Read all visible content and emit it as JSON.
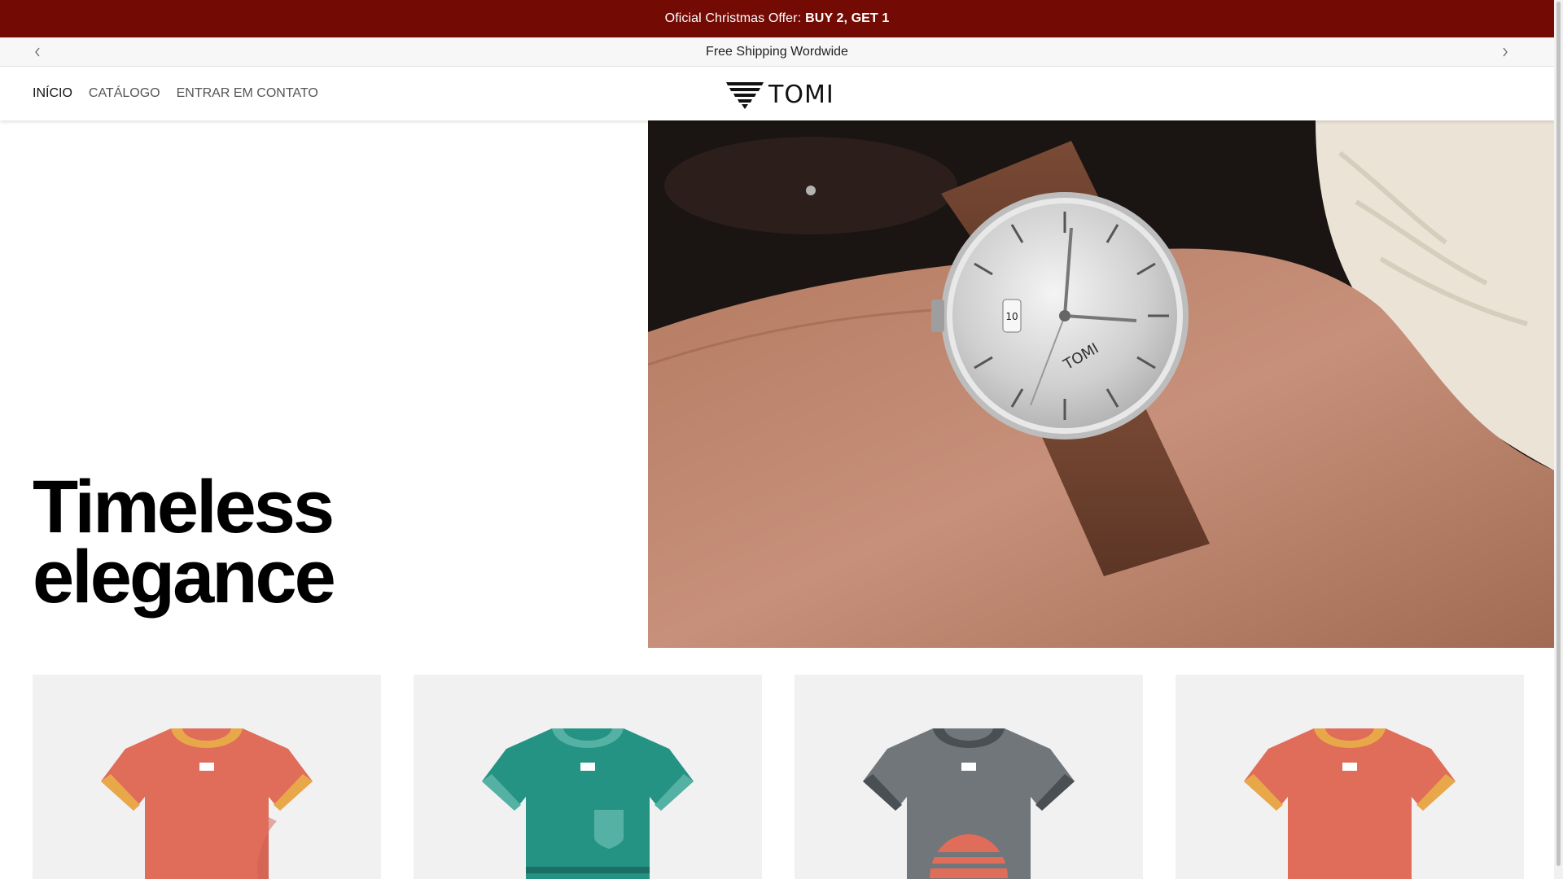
{
  "announcement": {
    "text": "Oficial Christmas Offer:",
    "highlight": "BUY 2, GET 1",
    "background": "#730A04"
  },
  "subbar": {
    "text": "Free Shipping Wordwide",
    "prev_icon": "chevron-left-icon",
    "next_icon": "chevron-right-icon"
  },
  "nav": {
    "items": [
      {
        "label": "INÍCIO",
        "active": true
      },
      {
        "label": "CATÁLOGO",
        "active": false
      },
      {
        "label": "ENTRAR EM CONTATO",
        "active": false
      }
    ]
  },
  "brand": {
    "name": "TOMI"
  },
  "header_icons": [
    "search-icon",
    "account-icon",
    "cart-icon"
  ],
  "hero": {
    "title_line1": "Timeless",
    "title_line2": "elegance",
    "image_icon": "watch-on-wrist-image",
    "watch_brand": "TOMI"
  },
  "products": [
    {
      "image": "tshirt-icon",
      "color": "#E06C5A",
      "accent": "#E8A84A"
    },
    {
      "image": "tshirt-icon",
      "color": "#249384",
      "accent": "#55B1A4"
    },
    {
      "image": "tshirt-icon",
      "color": "#70767A",
      "accent": "#4A4F53"
    },
    {
      "image": "tshirt-icon",
      "color": "#E06C5A",
      "accent": "#E8A84A"
    }
  ]
}
